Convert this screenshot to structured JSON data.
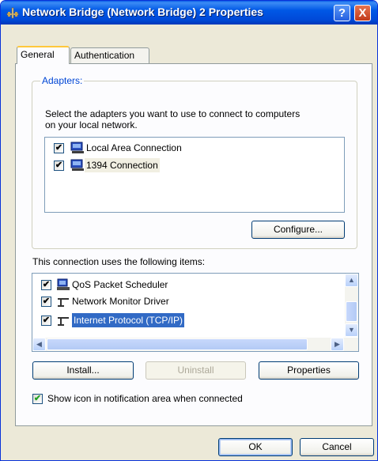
{
  "window": {
    "title": "Network Bridge (Network Bridge) 2 Properties"
  },
  "titlebar": {
    "help_label": "?",
    "close_label": "X"
  },
  "tabs": [
    {
      "label": "General",
      "active": true
    },
    {
      "label": "Authentication",
      "active": false
    }
  ],
  "adapters": {
    "group_label": "Adapters:",
    "description_line1": "Select the adapters you want to use to connect to computers",
    "description_line2": "on your local network.",
    "items": [
      {
        "label": "Local Area Connection",
        "checked": true
      },
      {
        "label": "1394 Connection",
        "checked": true
      }
    ],
    "configure_label": "Configure..."
  },
  "components": {
    "heading": "This connection uses the following items:",
    "items": [
      {
        "label": "QoS Packet Scheduler",
        "checked": true
      },
      {
        "label": "Network Monitor Driver",
        "checked": true
      },
      {
        "label": "Internet Protocol (TCP/IP)",
        "checked": true,
        "selected": true
      }
    ],
    "install_label": "Install...",
    "uninstall_label": "Uninstall",
    "properties_label": "Properties"
  },
  "notify": {
    "label": "Show icon in notification area when connected",
    "checked": true
  },
  "footer": {
    "ok_label": "OK",
    "cancel_label": "Cancel"
  },
  "colors": {
    "titlebar": "#0058E6",
    "selection": "#316AC5",
    "group_label": "#0046D5",
    "tab_highlight": "#FFC83C"
  }
}
